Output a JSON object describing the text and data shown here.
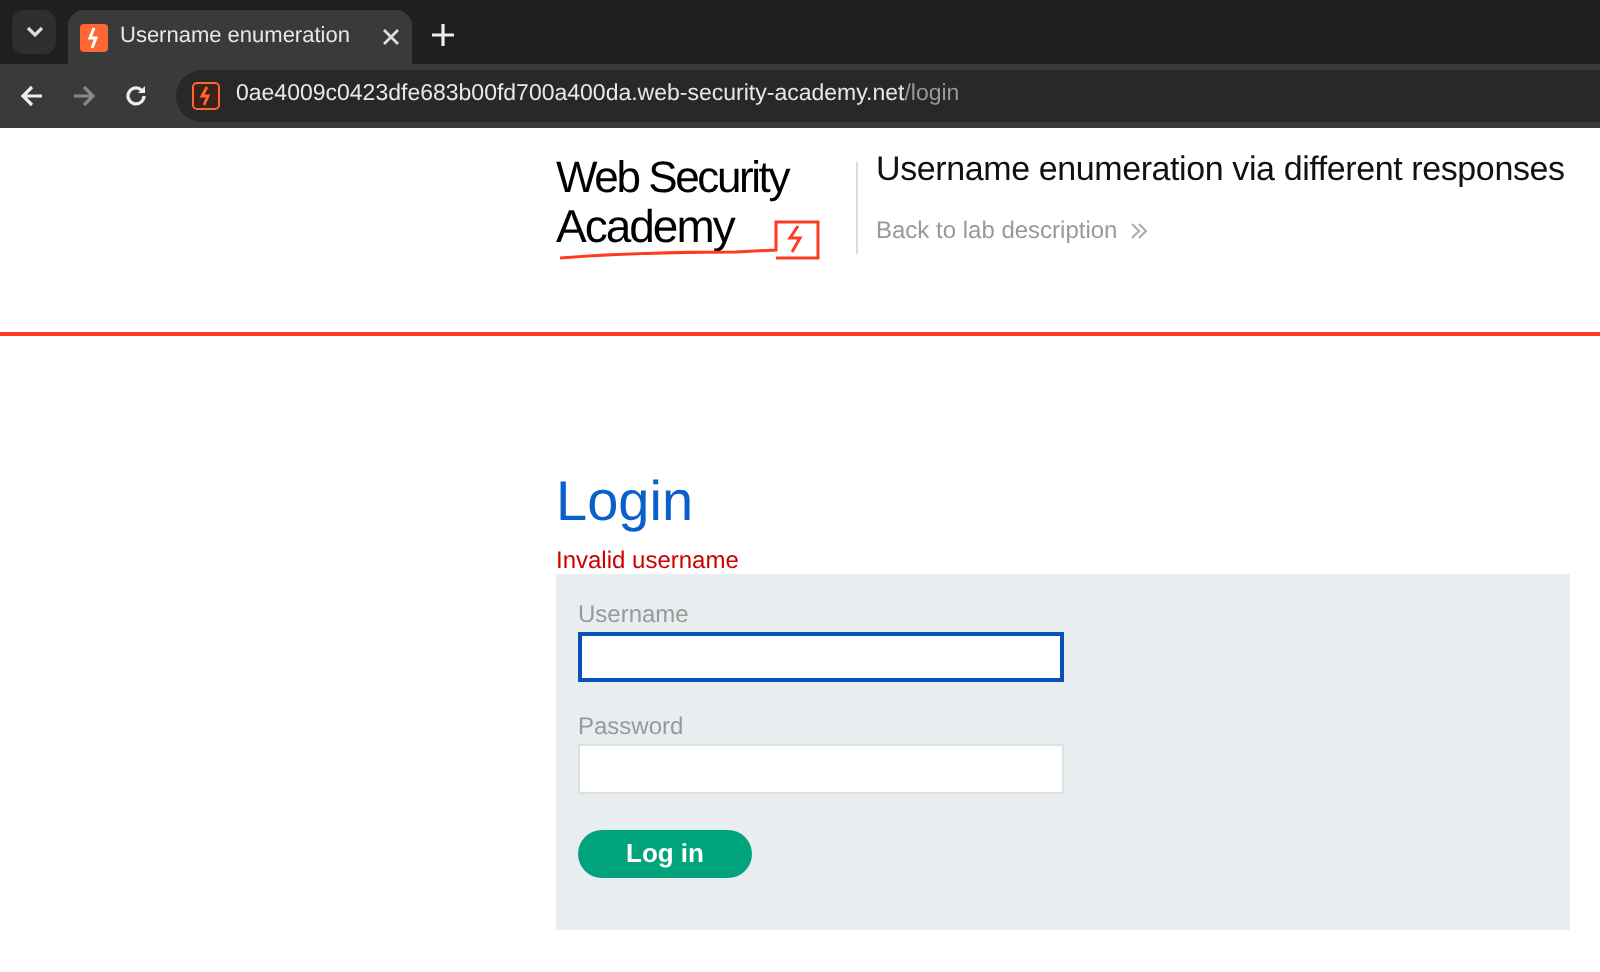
{
  "browser": {
    "tab": {
      "title": "Username enumeration",
      "selected": true
    },
    "url": {
      "host": "0ae4009c0423dfe683b00fd700a400da.web-security-academy.net",
      "path": "/login"
    }
  },
  "header": {
    "logo": {
      "line_1": "Web Security",
      "line_2": "Academy"
    },
    "title": "Username enumeration via different responses",
    "back_link": "Back to lab description"
  },
  "page": {
    "heading": "Login",
    "error": "Invalid username",
    "fields": [
      {
        "label": "Username",
        "focused": true
      },
      {
        "label": "Password",
        "focused": false
      }
    ],
    "button": "Log in"
  }
}
